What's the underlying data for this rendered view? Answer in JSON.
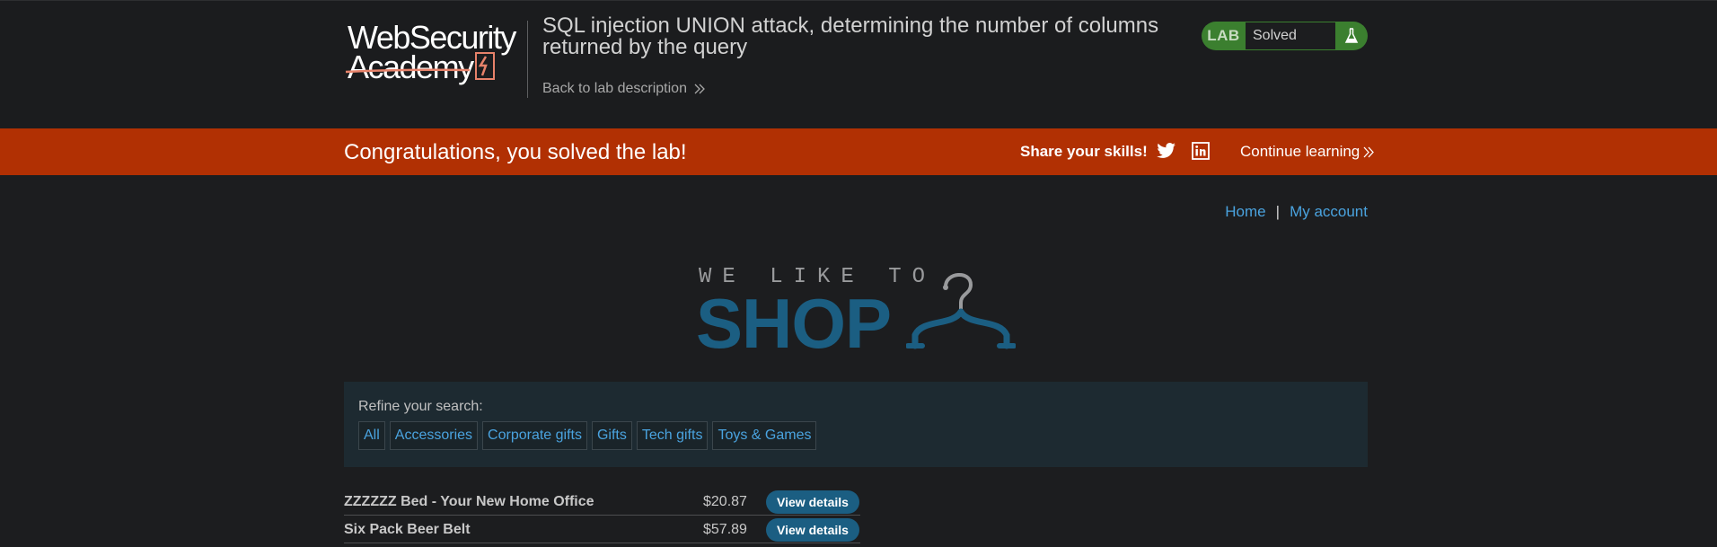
{
  "header": {
    "logo_line1": "WebSecurity",
    "logo_line2": "Academy",
    "lab_title": "SQL injection UNION attack, determining the number of columns returned by the query",
    "back_link": "Back to lab description",
    "badge_label": "LAB",
    "badge_status": "Solved"
  },
  "banner": {
    "message": "Congratulations, you solved the lab!",
    "share_label": "Share your skills!",
    "continue_label": "Continue learning"
  },
  "nav": {
    "home": "Home",
    "separator": "|",
    "account": "My account"
  },
  "shop_logo": {
    "small_text": "WE LIKE TO",
    "big_text": "SHOP"
  },
  "filter": {
    "label": "Refine your search:",
    "categories": [
      "All",
      "Accessories",
      "Corporate gifts",
      "Gifts",
      "Tech gifts",
      "Toys & Games"
    ]
  },
  "products": [
    {
      "name": "ZZZZZZ Bed - Your New Home Office",
      "price": "$20.87",
      "button": "View details"
    },
    {
      "name": "Six Pack Beer Belt",
      "price": "$57.89",
      "button": "View details"
    }
  ],
  "colors": {
    "banner": "#b13003",
    "badge_green": "#3b7f2f",
    "link": "#4aa3df",
    "shop_blue": "#1b5e82"
  }
}
